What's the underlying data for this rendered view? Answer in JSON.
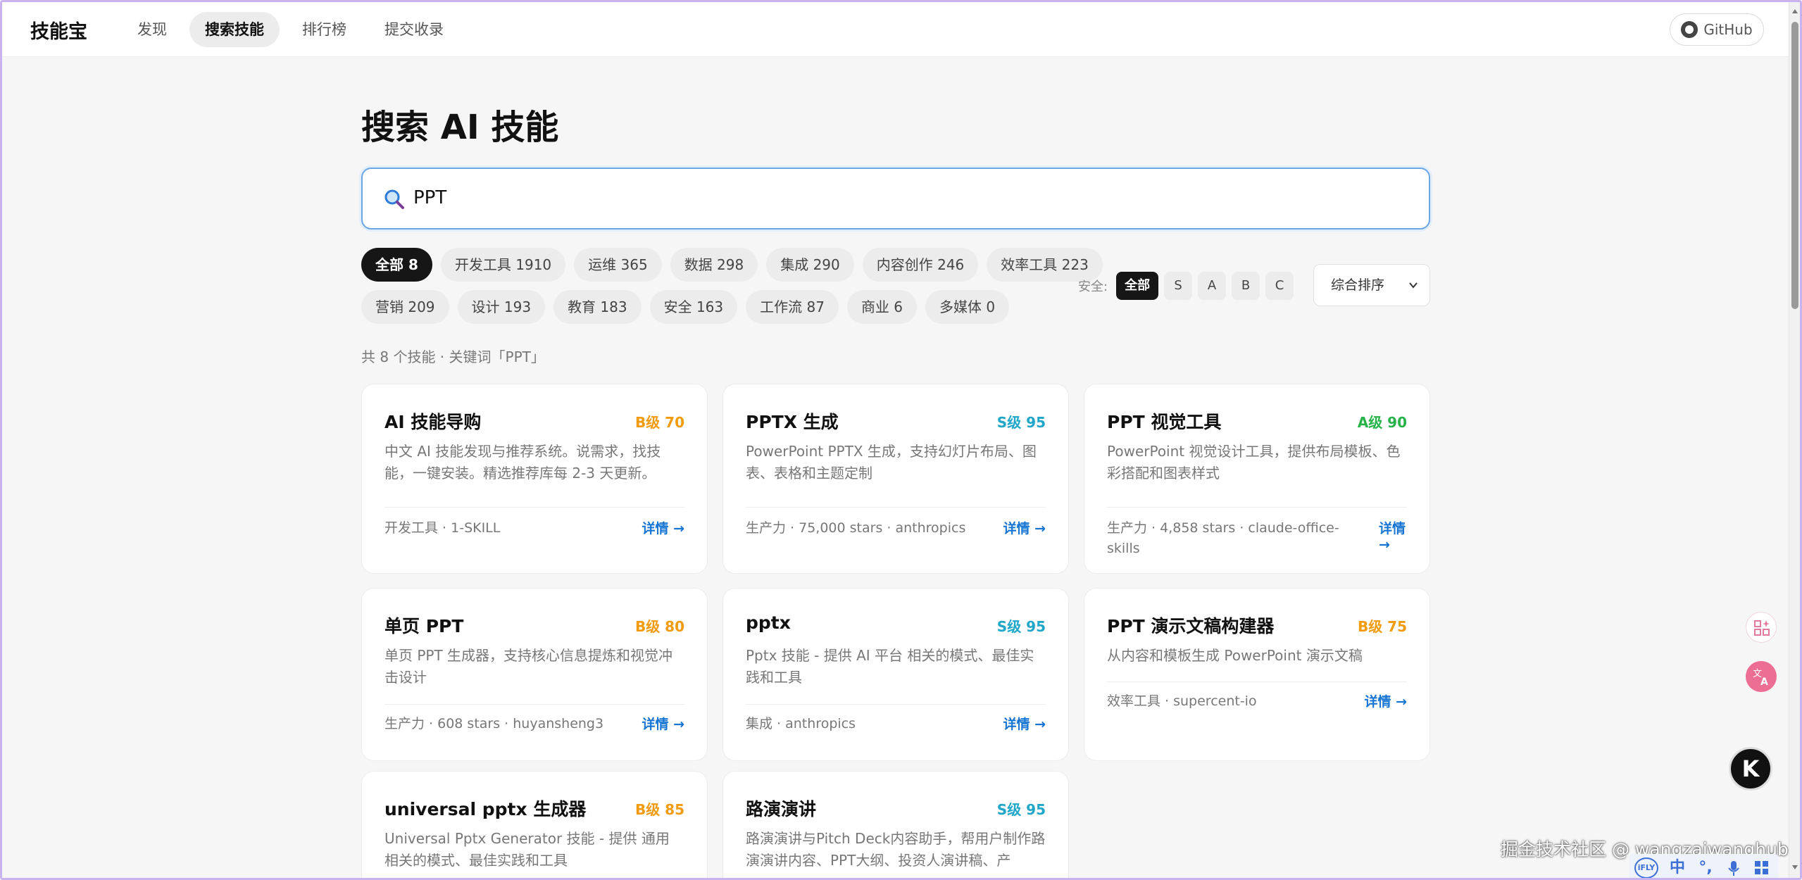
{
  "brand": "技能宝",
  "nav": [
    {
      "label": "发现",
      "active": false
    },
    {
      "label": "搜索技能",
      "active": true
    },
    {
      "label": "排行榜",
      "active": false
    },
    {
      "label": "提交收录",
      "active": false
    }
  ],
  "github_label": "GitHub",
  "page_title": "搜索 AI 技能",
  "search": {
    "value": "PPT"
  },
  "categories_row1": [
    {
      "label": "全部 8",
      "active": true
    },
    {
      "label": "开发工具 1910"
    },
    {
      "label": "运维 365"
    },
    {
      "label": "数据 298"
    },
    {
      "label": "集成 290"
    },
    {
      "label": "内容创作 246"
    },
    {
      "label": "效率工具 223"
    }
  ],
  "categories_row2": [
    {
      "label": "营销 209"
    },
    {
      "label": "设计 193"
    },
    {
      "label": "教育 183"
    },
    {
      "label": "安全 163"
    },
    {
      "label": "工作流 87"
    },
    {
      "label": "商业 6"
    },
    {
      "label": "多媒体 0"
    }
  ],
  "safety": {
    "label": "安全:",
    "grades": [
      {
        "label": "全部",
        "active": true
      },
      {
        "label": "S"
      },
      {
        "label": "A"
      },
      {
        "label": "B"
      },
      {
        "label": "C"
      }
    ]
  },
  "sort": {
    "selected": "综合排序"
  },
  "summary": "共 8 个技能 · 关键词「PPT」",
  "colors": {
    "grade_s": "#1fa6c9",
    "grade_a": "#27b34a",
    "grade_b": "#f29b0e",
    "link": "#1675d2"
  },
  "cards": [
    {
      "title": "AI 技能导购",
      "grade": "B级 70",
      "grade_class": "b",
      "desc": "中文 AI 技能发现与推荐系统。说需求，找技能，一键安装。精选推荐库每 2-3 天更新。",
      "meta": "开发工具 · 1-SKILL",
      "link": "详情 →"
    },
    {
      "title": "PPTX 生成",
      "grade": "S级 95",
      "grade_class": "s",
      "desc": "PowerPoint PPTX 生成，支持幻灯片布局、图表、表格和主题定制",
      "meta": "生产力 · 75,000 stars · anthropics",
      "link": "详情 →"
    },
    {
      "title": "PPT 视觉工具",
      "grade": "A级 90",
      "grade_class": "a",
      "desc": "PowerPoint 视觉设计工具，提供布局模板、色彩搭配和图表样式",
      "meta": "生产力 · 4,858 stars · claude-office-skills",
      "link": "详情 →"
    },
    {
      "title": "单页 PPT",
      "grade": "B级 80",
      "grade_class": "b",
      "desc": "单页 PPT 生成器，支持核心信息提炼和视觉冲击设计",
      "meta": "生产力 · 608 stars · huyansheng3",
      "link": "详情 →"
    },
    {
      "title": "pptx",
      "grade": "S级 95",
      "grade_class": "s",
      "desc": "Pptx 技能 - 提供 AI 平台 相关的模式、最佳实践和工具",
      "meta": "集成 · anthropics",
      "link": "详情 →"
    },
    {
      "title": "PPT 演示文稿构建器",
      "grade": "B级 75",
      "grade_class": "b",
      "desc": "从内容和模板生成 PowerPoint 演示文稿",
      "meta": "效率工具 · supercent-io",
      "link": "详情 →"
    },
    {
      "title": "universal pptx 生成器",
      "grade": "B级 85",
      "grade_class": "b",
      "desc": "Universal Pptx Generator 技能 - 提供 通用 相关的模式、最佳实践和工具",
      "meta": "",
      "link": ""
    },
    {
      "title": "路演演讲",
      "grade": "S级 95",
      "grade_class": "s",
      "desc": "路演演讲与Pitch Deck内容助手，帮用户制作路演演讲内容、PPT大纲、投资人演讲稿、产",
      "meta": "",
      "link": ""
    }
  ],
  "k_badge": "K",
  "watermark": "掘金技术社区 @ wangzaiwanghub",
  "ifly": {
    "logo": "iFLY",
    "lang": "中"
  }
}
